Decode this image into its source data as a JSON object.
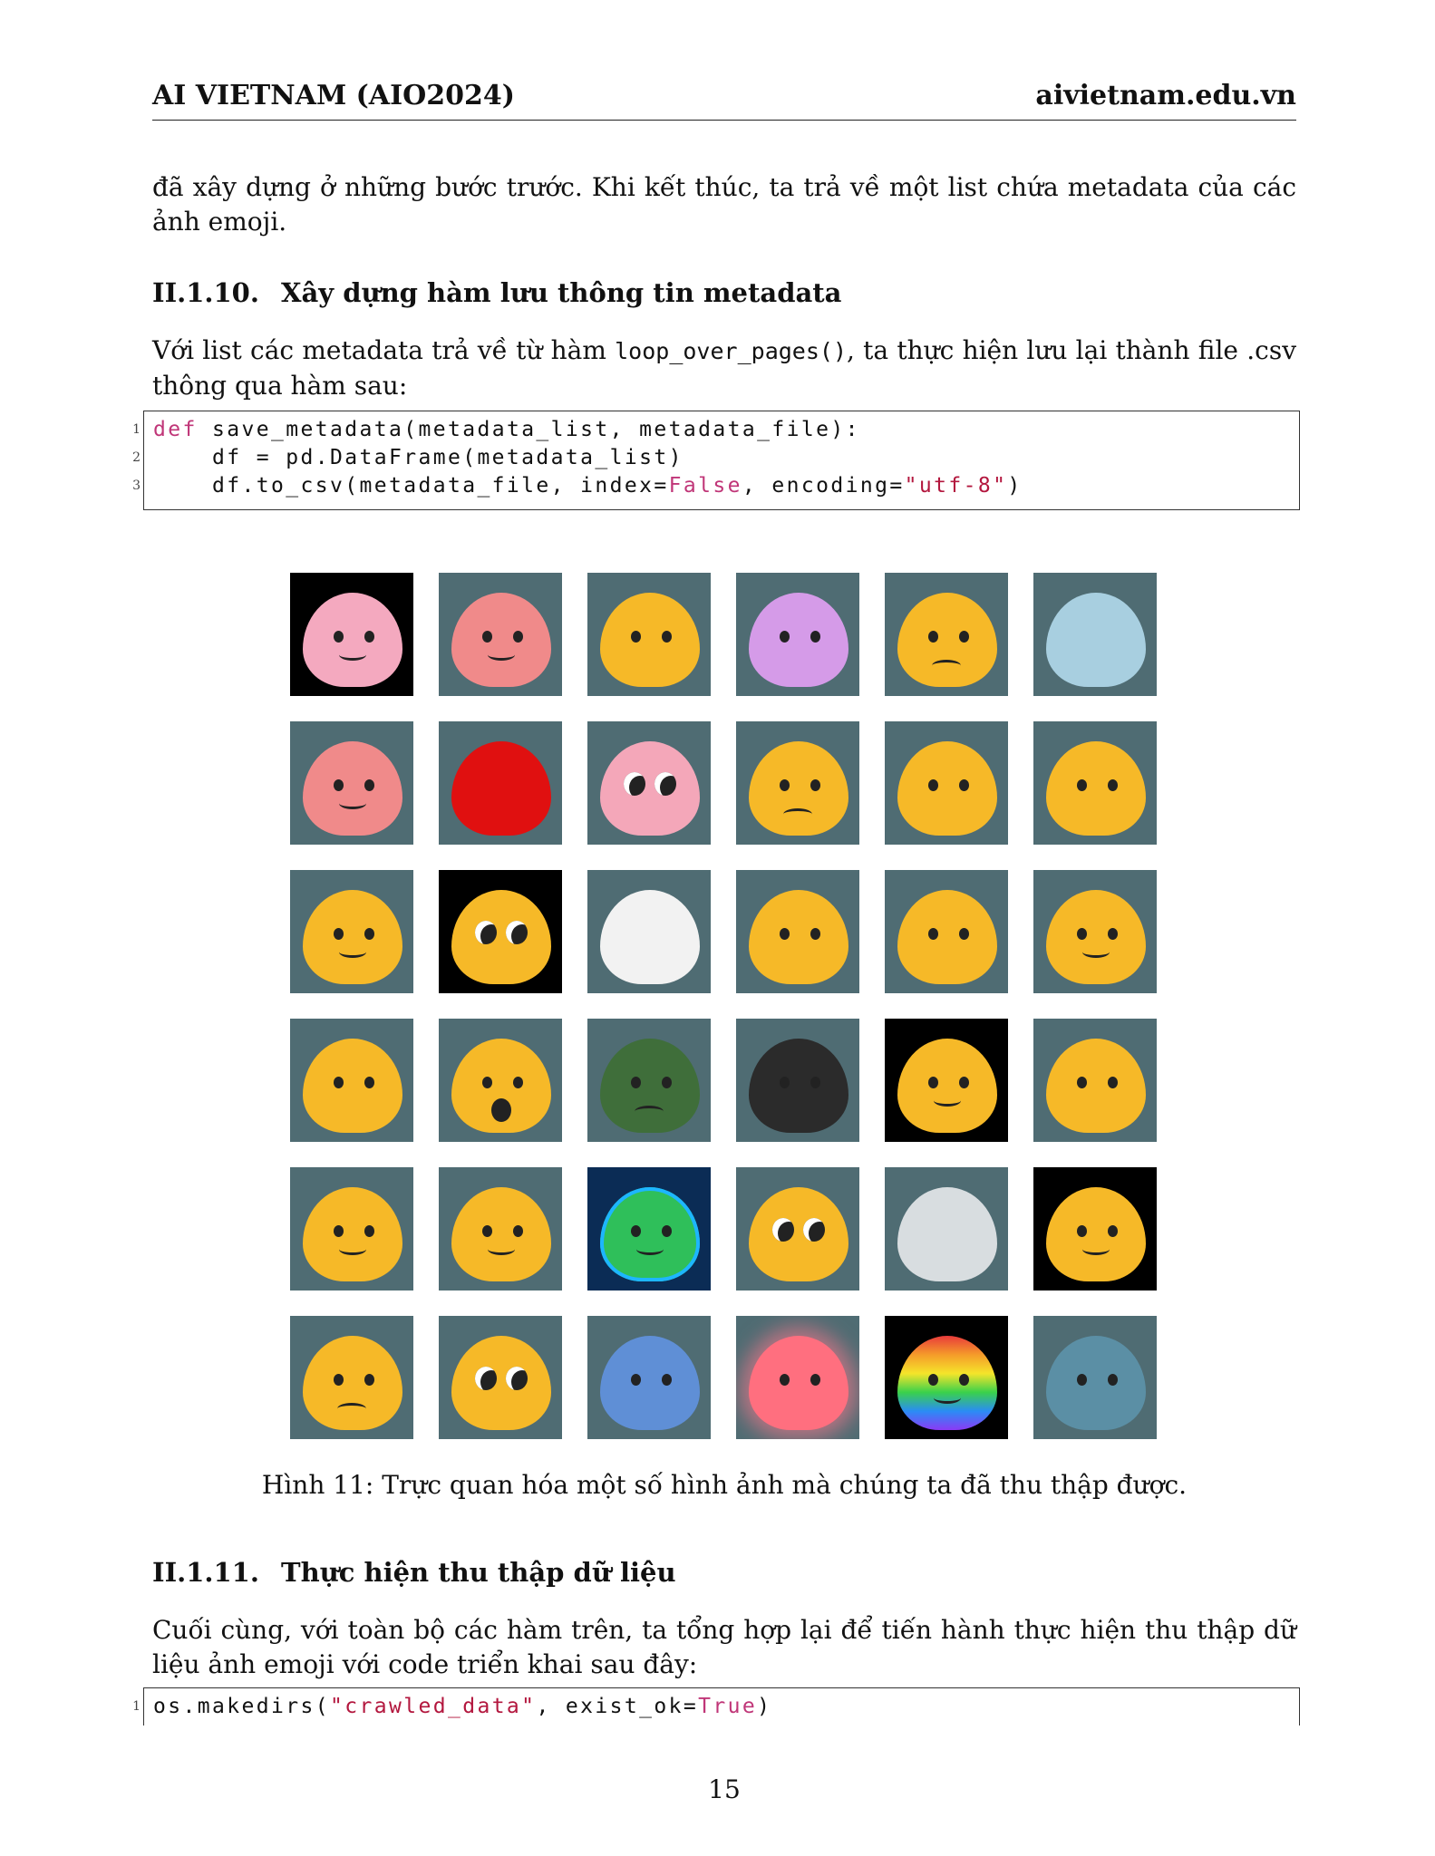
{
  "header": {
    "left": "AI VIETNAM (AIO2024)",
    "right": "aivietnam.edu.vn"
  },
  "intro_text": "đã xây dựng ở những bước trước. Khi kết thúc, ta trả về một list chứa metadata của các ảnh emoji.",
  "section_10": {
    "number": "II.1.10.",
    "title": "Xây dựng hàm lưu thông tin metadata",
    "text_before": "Với list các metadata trả về từ hàm ",
    "text_code": "loop_over_pages()",
    "text_after": ", ta thực hiện lưu lại thành file .csv thông qua hàm sau:"
  },
  "code1": {
    "line_numbers": [
      "1",
      "2",
      "3"
    ],
    "l1_kw": "def",
    "l1_rest": " save_metadata(metadata_list, metadata_file):",
    "l2": "    df = pd.DataFrame(metadata_list)",
    "l3_a": "    df.to_csv(metadata_file, index=",
    "l3_kw": "False",
    "l3_b": ", encoding=",
    "l3_str": "\"utf-8\"",
    "l3_c": ")"
  },
  "figure": {
    "caption": "Hình 11: Trực quan hóa một số hình ảnh mà chúng ta đã thu thập được.",
    "emojis": [
      "trans-blob-icon",
      "pink-blob-with-chick-icon",
      "cat-peek-icon",
      "purple-blob-hearts-icon",
      "sad-blob-icon",
      "shark-icon",
      "pink-blob-icon",
      "red-blob-icon",
      "pink-blob-big-eyes-icon",
      "blob-thermometer-icon",
      "blob-thinking-icon",
      "cat-crying-icon",
      "cat-blob-icon",
      "blob-googly-eyes-icon",
      "white-blob-icon",
      "blob-witch-icon",
      "blob-gift-icon",
      "blob-ninja-icon",
      "blob-glasses-icon",
      "blob-shocked-icon",
      "green-blob-sad-icon",
      "dark-blob-icon",
      "blob-happy-tears-icon",
      "hand-petting-blob-icon",
      "blob-wave-icon",
      "blob-reading-icon",
      "galaxy-blob-icon",
      "blob-pleading-icon",
      "blob-toilet-icon",
      "blob-cowboy-icon",
      "blob-angry-hug-icon",
      "blob-hearts-eyes-icon",
      "blue-cat-icon",
      "blob-glowing-thinking-icon",
      "rainbow-fire-blob-icon",
      "shark-peek-icon"
    ]
  },
  "section_11": {
    "number": "II.1.11.",
    "title": "Thực hiện thu thập dữ liệu",
    "text": "Cuối cùng, với toàn bộ các hàm trên, ta tổng hợp lại để tiến hành thực hiện thu thập dữ liệu ảnh emoji với code triển khai sau đây:"
  },
  "code2": {
    "line_number": "1",
    "a": "os.makedirs(",
    "str": "\"crawled_data\"",
    "b": ", exist_ok=",
    "kw": "True",
    "c": ")"
  },
  "page_number": "15"
}
